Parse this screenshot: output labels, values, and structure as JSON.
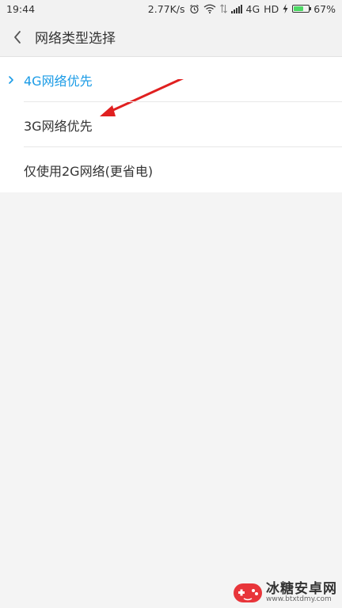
{
  "status_bar": {
    "time": "19:44",
    "speed": "2.77K/s",
    "network": "4G",
    "hd": "HD",
    "battery": "67%",
    "battery_level": 0.67,
    "icons": [
      "alarm-icon",
      "wifi-icon",
      "signal-icon",
      "charging-icon",
      "battery-icon"
    ]
  },
  "header": {
    "title": "网络类型选择",
    "back_icon": "chevron-left-icon"
  },
  "options": [
    {
      "label": "4G网络优先",
      "selected": true
    },
    {
      "label": "3G网络优先",
      "selected": false
    },
    {
      "label": "仅使用2G网络(更省电)",
      "selected": false
    }
  ],
  "colors": {
    "accent": "#1a9be6",
    "annotation": "#e02020",
    "background": "#f4f4f4"
  },
  "watermark": {
    "title": "冰糖安卓网",
    "url": "www.btxtdmy.com"
  }
}
